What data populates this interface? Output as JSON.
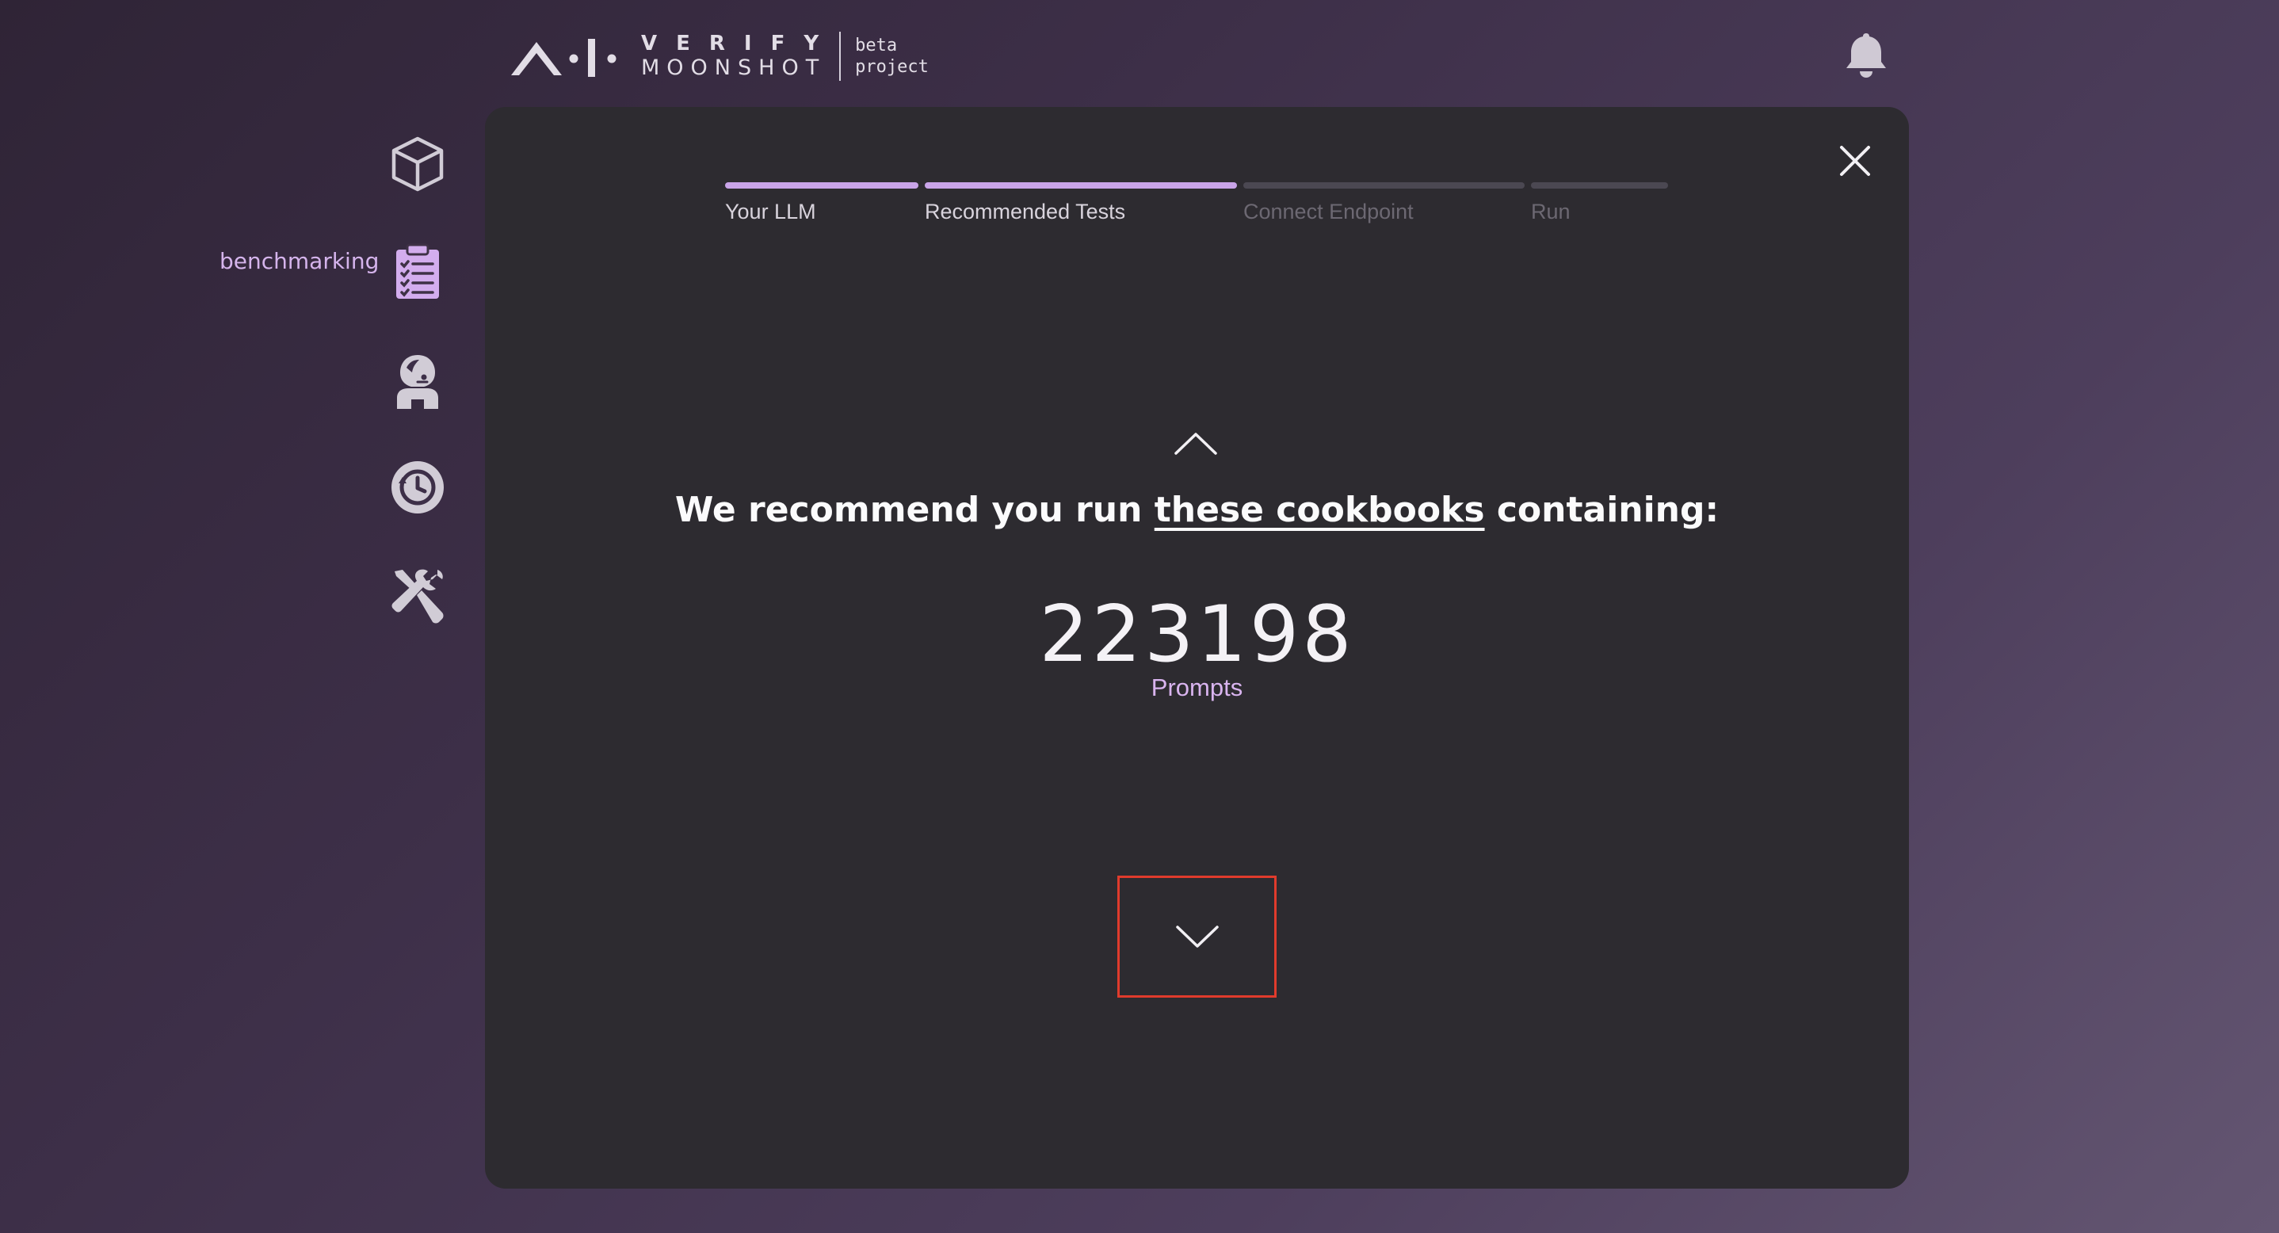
{
  "header": {
    "logo_word_top": "VERIFY",
    "logo_word_bottom": "MOONSHOT",
    "logo_tag_top": "beta",
    "logo_tag_bottom": "project"
  },
  "sidebar": {
    "items": [
      {
        "icon": "cube-icon",
        "label": ""
      },
      {
        "icon": "clipboard-checklist-icon",
        "label": "benchmarking"
      },
      {
        "icon": "red-teaming-agent-icon",
        "label": ""
      },
      {
        "icon": "history-icon",
        "label": ""
      },
      {
        "icon": "tools-icon",
        "label": ""
      }
    ],
    "active_index": 1
  },
  "stepper": {
    "steps": [
      {
        "label": "Your LLM",
        "state": "completed"
      },
      {
        "label": "Recommended Tests",
        "state": "current"
      },
      {
        "label": "Connect Endpoint",
        "state": "upcoming"
      },
      {
        "label": "Run",
        "state": "upcoming"
      }
    ]
  },
  "content": {
    "headline_before": "We recommend you run ",
    "headline_link": "these cookbooks",
    "headline_after": " containing:",
    "count_value": "223198",
    "count_label": "Prompts"
  },
  "colors": {
    "accent": "#c9a4e8",
    "modal_bg": "#2d2b30",
    "highlight_border": "#e03b2c"
  }
}
